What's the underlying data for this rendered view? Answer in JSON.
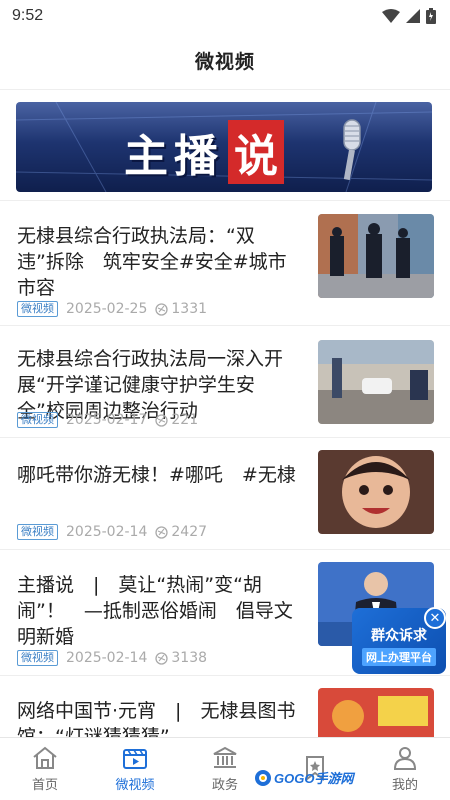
{
  "status_bar": {
    "time": "9:52"
  },
  "header": {
    "title": "微视频"
  },
  "banner": {
    "chars": [
      "主",
      "播"
    ],
    "highlight": "说"
  },
  "news": [
    {
      "title": "无棣县综合行政执法局：“双违”拆除　筑牢安全#安全#城市市容",
      "tag": "微视频",
      "date": "2025-02-25",
      "views": "1331"
    },
    {
      "title": "无棣县综合行政执法局一深入开展“开学谨记健康守护学生安全”校园周边整治行动",
      "tag": "微视频",
      "date": "2025-02-17",
      "views": "221"
    },
    {
      "title": "哪吒带你游无棣！#哪吒　#无棣",
      "tag": "微视频",
      "date": "2025-02-14",
      "views": "2427"
    },
    {
      "title": "主播说　|　莫让“热闹”变“胡闹”！　—抵制恶俗婚闹　倡导文明新婚",
      "tag": "微视频",
      "date": "2025-02-14",
      "views": "3138"
    },
    {
      "title": "网络中国节·元宵　|　无棣县图书馆：“灯谜猜猜猜”",
      "tag": "",
      "date": "",
      "views": ""
    }
  ],
  "float_badge": {
    "line1": "群众诉求",
    "line2": "网上办理平台",
    "close": "✕"
  },
  "bottom_nav": [
    {
      "label": "首页",
      "icon": "home-icon",
      "active": false
    },
    {
      "label": "微视频",
      "icon": "video-icon",
      "active": true
    },
    {
      "label": "政务",
      "icon": "government-icon",
      "active": false
    },
    {
      "label": "",
      "icon": "bookmark-icon",
      "active": false
    },
    {
      "label": "我的",
      "icon": "user-icon",
      "active": false
    }
  ],
  "watermark": {
    "text": "GOGO手游网"
  },
  "colors": {
    "accent": "#1e6fd8",
    "tag_border": "#5a9bd5",
    "banner_red": "#d42a2a"
  }
}
